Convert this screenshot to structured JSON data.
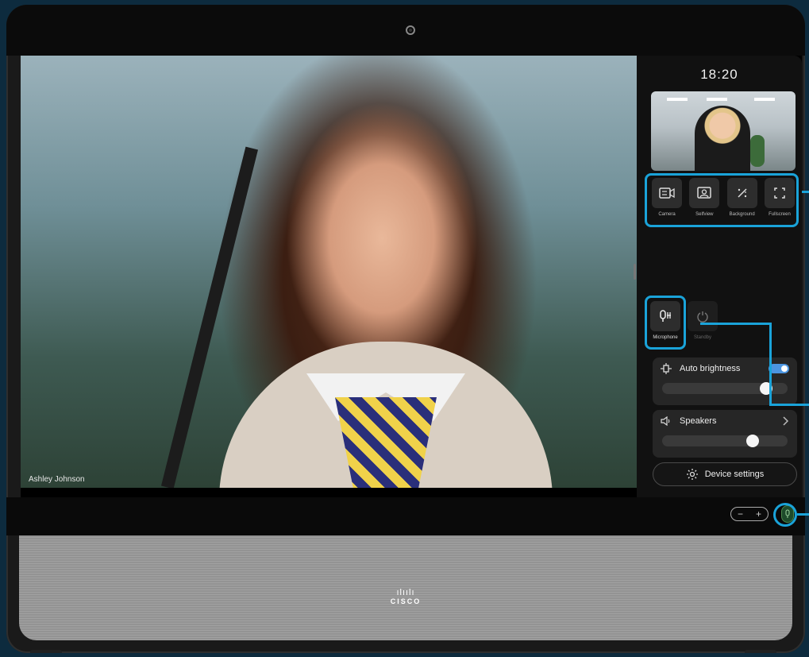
{
  "caller": {
    "name": "Ashley Johnson"
  },
  "panel": {
    "time": "18:20",
    "quick_actions": [
      {
        "label": "Camera",
        "icon": "camera-icon"
      },
      {
        "label": "Selfview",
        "icon": "selfview-icon"
      },
      {
        "label": "Background",
        "icon": "background-icon"
      },
      {
        "label": "Fullscreen",
        "icon": "fullscreen-icon"
      }
    ],
    "microphone_label": "Microphone",
    "standby_label": "Standby",
    "auto_brightness": {
      "label": "Auto brightness",
      "enabled": true,
      "level": 0.83
    },
    "speakers": {
      "label": "Speakers",
      "volume": 0.72
    },
    "device_settings_label": "Device settings"
  },
  "hardware": {
    "volume_minus": "−",
    "volume_plus": "+",
    "brand_bars": "ılıılı",
    "brand": "CISCO"
  },
  "colors": {
    "highlight": "#1aa3d9",
    "toggle_on": "#4c95e0",
    "panel_bg": "#111111"
  }
}
